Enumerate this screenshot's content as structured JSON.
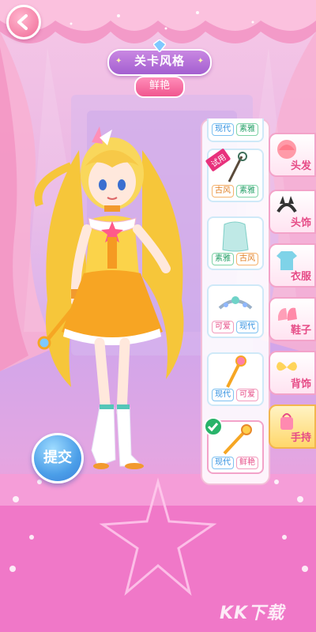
{
  "header": {
    "level_title": "关卡风格",
    "theme_tag": "鲜艳"
  },
  "character": {
    "hair_color": "#f7d04a",
    "outfit_color": "#f5a623"
  },
  "items": [
    {
      "tags": [
        "现代",
        "素雅"
      ],
      "partial": true
    },
    {
      "badge": "试用",
      "tags": [
        "古风",
        "素雅"
      ],
      "icon": "staff-icon"
    },
    {
      "tags": [
        "素雅",
        "古风"
      ],
      "icon": "veil-icon"
    },
    {
      "tags": [
        "可爱",
        "现代"
      ],
      "icon": "tiara-icon"
    },
    {
      "tags": [
        "现代",
        "可爱"
      ],
      "icon": "wand-icon"
    },
    {
      "tags": [
        "现代",
        "鲜艳"
      ],
      "icon": "scepter-icon",
      "selected": true
    }
  ],
  "categories": [
    {
      "label": "头发",
      "icon": "hair-icon"
    },
    {
      "label": "头饰",
      "icon": "headband-icon"
    },
    {
      "label": "衣服",
      "icon": "clothes-icon"
    },
    {
      "label": "鞋子",
      "icon": "shoes-icon"
    },
    {
      "label": "背饰",
      "icon": "wings-icon"
    },
    {
      "label": "手持",
      "icon": "handheld-icon",
      "active": true
    }
  ],
  "submit_label": "提交",
  "watermark": "KK下载",
  "colors": {
    "accent_pink": "#e64b86",
    "banner_purple": "#a35fd0",
    "submit_blue": "#4b9ee8"
  }
}
